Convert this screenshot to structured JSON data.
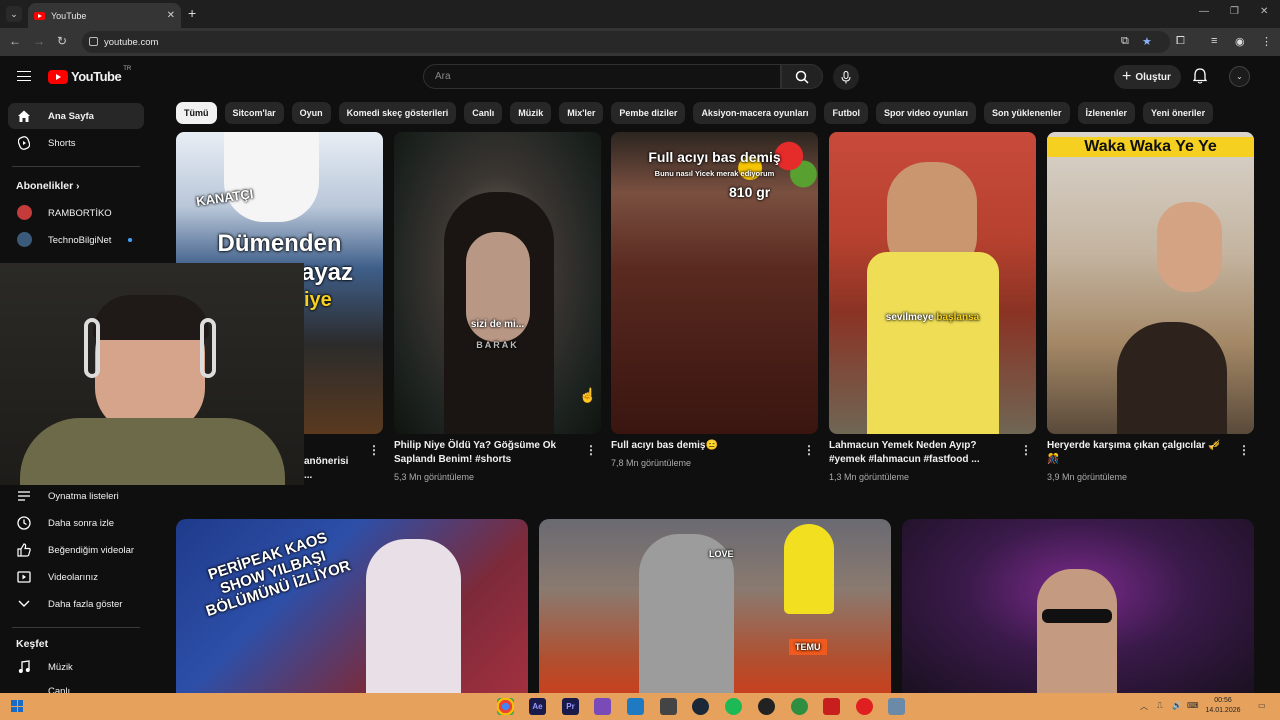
{
  "browser": {
    "tab_title": "YouTube",
    "url": "youtube.com"
  },
  "header": {
    "logo_text": "YouTube",
    "logo_region": "TR",
    "search_placeholder": "Ara",
    "create_label": "Oluştur"
  },
  "sidebar": {
    "main": [
      {
        "label": "Ana Sayfa",
        "icon": "home-icon"
      },
      {
        "label": "Shorts",
        "icon": "shorts-icon"
      }
    ],
    "subscriptions_title": "Abonelikler",
    "subscriptions": [
      {
        "label": "RAMBORTİKO"
      },
      {
        "label": "TechnoBilgiNet"
      }
    ],
    "you_items": [
      {
        "label": "Oynatma listeleri",
        "icon": "playlist-icon"
      },
      {
        "label": "Daha sonra izle",
        "icon": "clock-icon"
      },
      {
        "label": "Beğendiğim videolar",
        "icon": "thumbs-up-icon"
      },
      {
        "label": "Videolarınız",
        "icon": "video-icon"
      },
      {
        "label": "Daha fazla göster",
        "icon": "chevron-down-icon"
      }
    ],
    "explore_title": "Keşfet",
    "explore": [
      {
        "label": "Müzik",
        "icon": "music-icon"
      },
      {
        "label": "Canlı",
        "icon": "live-icon"
      }
    ]
  },
  "chips": [
    "Tümü",
    "Sitcom'lar",
    "Oyun",
    "Komedi skeç gösterileri",
    "Canlı",
    "Müzik",
    "Mix'ler",
    "Pembe diziler",
    "Aksiyon-macera oyunları",
    "Futbol",
    "Spor video oyunları",
    "Son yüklenenler",
    "İzlenenler",
    "Yeni öneriler"
  ],
  "shorts": [
    {
      "title": "anönerisi ...",
      "views": "",
      "overlay": "Dümenden",
      "overlay2": "ayaz",
      "overlay3": "iye",
      "sign": "KANATÇI"
    },
    {
      "title": "Philip Niye Öldü Ya? Göğsüme Ok Saplandı Benim! #shorts",
      "views": "5,3 Mn görüntüleme",
      "overlay": "sizi de mi...",
      "overlay2": "BARAK"
    },
    {
      "title": "Full acıyı bas demiş😑",
      "views": "7,8 Mn görüntüleme",
      "overlay": "Full acıyı bas demiş",
      "overlay2": "Bunu nasıl Yicek merak ediyorum",
      "overlay3": "810 gr"
    },
    {
      "title": "Lahmacun Yemek Neden Ayıp? #yemek #lahmacun #fastfood ...",
      "views": "1,3 Mn görüntüleme",
      "overlay": "sevilmeye",
      "overlay2": "başlansa"
    },
    {
      "title": "Heryerde karşıma çıkan çalgıcılar 🎺🎊",
      "views": "3,9 Mn görüntüleme",
      "overlay": "Waka Waka Ye Ye"
    }
  ],
  "videos": [
    {
      "overlay": "PERİPEAK KAOS SHOW YILBAŞI BÖLÜMÜNÜ İZLİYOR"
    },
    {
      "overlay": "TEMU",
      "overlay2": "LOVE"
    },
    {
      "overlay": ""
    }
  ],
  "taskbar": {
    "time": "00:56",
    "date": "14.01.2026"
  }
}
